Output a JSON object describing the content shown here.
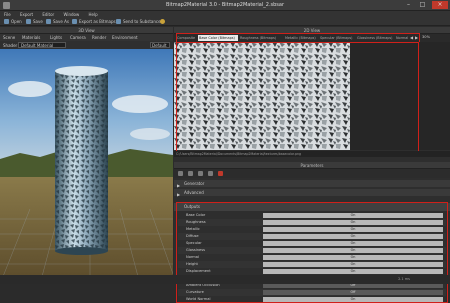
{
  "window": {
    "title": "Bitmap2Material 3.0 - Bitmap2Material_2.sbsar"
  },
  "menu": [
    {
      "label": "File"
    },
    {
      "label": "Export"
    },
    {
      "label": "Editor"
    },
    {
      "label": "Window"
    },
    {
      "label": "Help"
    }
  ],
  "toolbar": [
    {
      "label": "Open"
    },
    {
      "label": "Save"
    },
    {
      "label": "Save As"
    },
    {
      "label": "Export as Bitmaps"
    },
    {
      "label": "Send to Substance"
    }
  ],
  "view3d": {
    "header": "3D View",
    "menu": [
      {
        "label": "Scene"
      },
      {
        "label": "Materials"
      },
      {
        "label": "Lights"
      },
      {
        "label": "Camera"
      },
      {
        "label": "Render"
      },
      {
        "label": "Environment"
      }
    ],
    "material_label": "Shader",
    "material_value": "Default Material",
    "material_slot": "Default"
  },
  "view2d": {
    "header": "2D View",
    "tabs": [
      {
        "label": "Composite"
      },
      {
        "label": "Base Color (Bitmaps)"
      },
      {
        "label": "Roughness (Bitmaps)"
      },
      {
        "label": "Metallic (Bitmaps)"
      },
      {
        "label": "Specular (Bitmaps)"
      },
      {
        "label": "Glossiness (Bitmaps)"
      },
      {
        "label": "Normal (Bitmaps)"
      }
    ],
    "zoom": "30%",
    "path": "C:/Users/Bitmap2Material/Documents/Bitmap2Material/textures/basecolor.png"
  },
  "parameters": {
    "header": "Parameters",
    "sections": [
      {
        "label": "Generator"
      },
      {
        "label": "Advanced"
      }
    ],
    "outputs_label": "Outputs",
    "rows": [
      {
        "label": "Base Color",
        "value": "On"
      },
      {
        "label": "Roughness",
        "value": "On"
      },
      {
        "label": "Metallic",
        "value": "On"
      },
      {
        "label": "Diffuse",
        "value": "On"
      },
      {
        "label": "Specular",
        "value": "On"
      },
      {
        "label": "Glossiness",
        "value": "On"
      },
      {
        "label": "Normal",
        "value": "On"
      },
      {
        "label": "Height",
        "value": "On"
      },
      {
        "label": "Displacement",
        "value": "On"
      },
      {
        "label": "Bump",
        "value": "Off"
      },
      {
        "label": "Ambient Occlusion",
        "value": "Off"
      },
      {
        "label": "Curvature",
        "value": "Off"
      },
      {
        "label": "World Normal",
        "value": "On"
      }
    ]
  },
  "status": {
    "text": "2.1 ms"
  },
  "colors": {
    "highlight_border": "#d0201a",
    "row_on": "#b8b8b8",
    "row_off": "#5a5a5a"
  }
}
